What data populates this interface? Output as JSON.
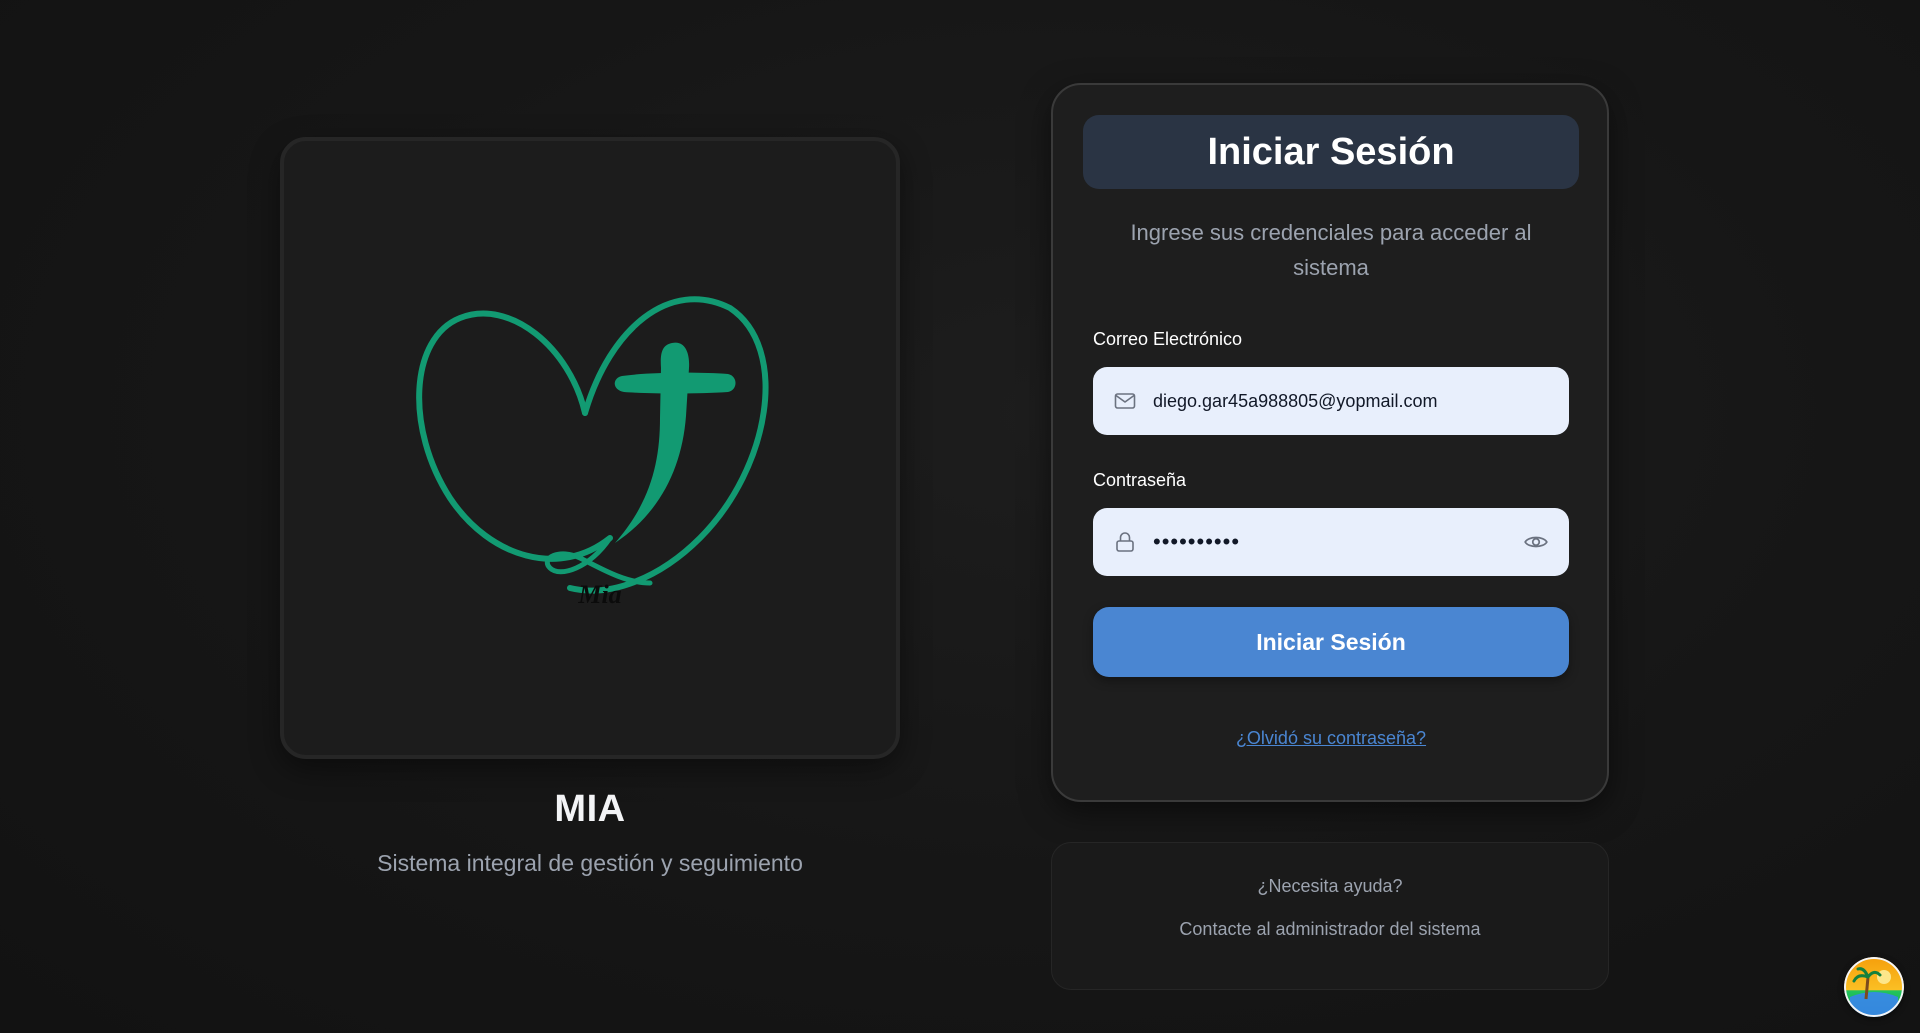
{
  "brand": {
    "name": "MIA",
    "tagline": "Sistema integral de gestión y seguimiento",
    "logo_caption": "Mia",
    "logo_color": "#129a72"
  },
  "login": {
    "title": "Iniciar Sesión",
    "subtitle": "Ingrese sus credenciales para acceder al sistema",
    "email": {
      "label": "Correo Electrónico",
      "value": "diego.gar45a988805@yopmail.com",
      "icon": "mail-icon"
    },
    "password": {
      "label": "Contraseña",
      "value": "••••••••••",
      "icon": "lock-icon",
      "toggle_icon": "eye-icon"
    },
    "submit_label": "Iniciar Sesión",
    "forgot_label": "¿Olvidó su contraseña?",
    "accent_color": "#4a86d2"
  },
  "help": {
    "title": "¿Necesita ayuda?",
    "text": "Contacte al administrador del sistema"
  },
  "floating_button": {
    "icon": "beach-avatar-icon"
  }
}
